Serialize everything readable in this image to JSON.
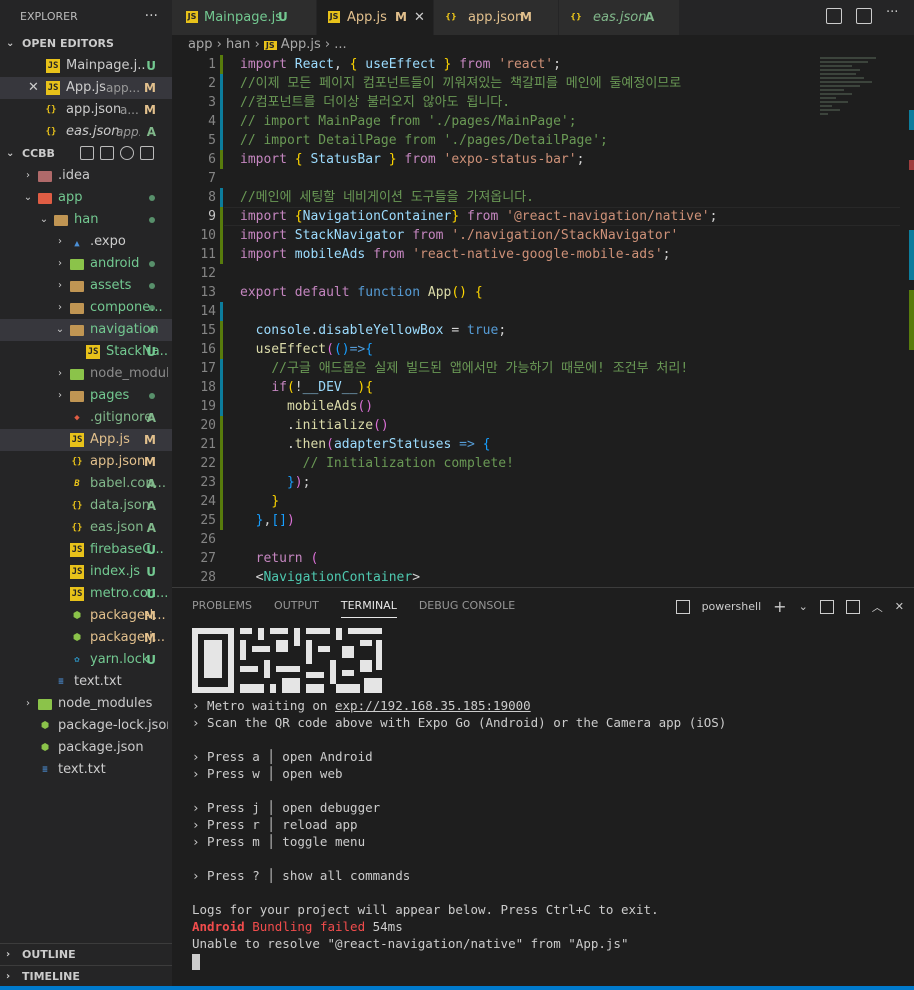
{
  "explorer": {
    "title": "EXPLORER",
    "more": "···",
    "open_editors": {
      "header": "OPEN EDITORS",
      "items": [
        {
          "name": "Mainpage.j...",
          "detail": "",
          "status": "U",
          "icon": "js-icon"
        },
        {
          "name": "App.js",
          "detail": "app...",
          "status": "M",
          "icon": "js-icon"
        },
        {
          "name": "app.json",
          "detail": "a...",
          "status": "M",
          "icon": "json-icon"
        },
        {
          "name": "eas.json",
          "detail": "app...",
          "status": "A",
          "icon": "json-icon"
        }
      ]
    },
    "project": {
      "header": "CCBB",
      "tree": [
        {
          "name": ".idea",
          "status": ""
        },
        {
          "name": "app",
          "status": ""
        },
        {
          "name": "han",
          "status": ""
        },
        {
          "name": ".expo",
          "status": ""
        },
        {
          "name": "android",
          "status": ""
        },
        {
          "name": "assets",
          "status": ""
        },
        {
          "name": "compone...",
          "status": ""
        },
        {
          "name": "navigation",
          "status": ""
        },
        {
          "name": "StackNa...",
          "status": "U"
        },
        {
          "name": "node_modules",
          "status": ""
        },
        {
          "name": "pages",
          "status": ""
        },
        {
          "name": ".gitignore",
          "status": "A"
        },
        {
          "name": "App.js",
          "status": "M"
        },
        {
          "name": "app.json",
          "status": "M"
        },
        {
          "name": "babel.con...",
          "status": "A"
        },
        {
          "name": "data.json",
          "status": "A"
        },
        {
          "name": "eas.json",
          "status": "A"
        },
        {
          "name": "firebaseC...",
          "status": "U"
        },
        {
          "name": "index.js",
          "status": "U"
        },
        {
          "name": "metro.con...",
          "status": "U"
        },
        {
          "name": "package-l...",
          "status": "M"
        },
        {
          "name": "package.j...",
          "status": "M"
        },
        {
          "name": "yarn.lock",
          "status": "U"
        },
        {
          "name": "text.txt",
          "status": ""
        },
        {
          "name": "node_modules",
          "status": ""
        },
        {
          "name": "package-lock.json",
          "status": ""
        },
        {
          "name": "package.json",
          "status": ""
        },
        {
          "name": "text.txt",
          "status": ""
        }
      ]
    },
    "outline": "OUTLINE",
    "timeline": "TIMELINE"
  },
  "tabs": [
    {
      "name": "Mainpage.js",
      "status": "U"
    },
    {
      "name": "App.js",
      "status": "M"
    },
    {
      "name": "app.json",
      "status": "M"
    },
    {
      "name": "eas.json",
      "status": "A"
    }
  ],
  "breadcrumb": [
    "app",
    "han",
    "App.js",
    "..."
  ],
  "editor": {
    "line_numbers": [
      "1",
      "2",
      "3",
      "4",
      "5",
      "6",
      "7",
      "8",
      "9",
      "10",
      "11",
      "12",
      "13",
      "14",
      "15",
      "16",
      "17",
      "18",
      "19",
      "20",
      "21",
      "22",
      "23",
      "24",
      "25",
      "26",
      "27",
      "28"
    ],
    "comments": {
      "l2": "//이제 모든 페이지 컴포넌트들이 끼워져있는 책갈피를 메인에 둘예정이므로",
      "l3": "//컴포넌트를 더이상 불러오지 않아도 됩니다.",
      "l4": "// import MainPage from './pages/MainPage';",
      "l5": "// import DetailPage from './pages/DetailPage';",
      "l8": "//메인에 세팅할 네비게이션 도구들을 가져옵니다.",
      "l17": "//구글 애드몹은 실제 빌드된 앱에서만 가능하기 때문에! 조건부 처리!",
      "l22": "// Initialization complete!"
    },
    "strings": {
      "react": "'react'",
      "expo_status_bar": "'expo-status-bar'",
      "nav_native": "'@react-navigation/native'",
      "stack_nav": "'./navigation/StackNavigator'",
      "ads": "'react-native-google-mobile-ads'"
    }
  },
  "panel": {
    "tabs": [
      "PROBLEMS",
      "OUTPUT",
      "TERMINAL",
      "DEBUG CONSOLE"
    ],
    "active_tab": "TERMINAL",
    "shell": "powershell",
    "terminal": {
      "metro": "› Metro waiting on ",
      "metro_url": "exp://192.168.35.185:19000",
      "scan": "› Scan the QR code above with Expo Go (Android) or the Camera app (iOS)",
      "press_a": "› Press a │ open Android",
      "press_w": "› Press w │ open web",
      "press_j": "› Press j │ open debugger",
      "press_r": "› Press r │ reload app",
      "press_m": "› Press m │ toggle menu",
      "press_q": "› Press ? │ show all commands",
      "logs": "Logs for your project will appear below. Press Ctrl+C to exit.",
      "bundling_platform": "Android",
      "bundling_msg": " Bundling failed ",
      "bundling_time": "54ms",
      "error": "Unable to resolve \"@react-navigation/native\" from \"App.js\""
    }
  },
  "colors": {
    "modified": "#e2c08d",
    "untracked": "#73c991",
    "added": "#81b88b",
    "error": "#f14c4c",
    "accent": "#007acc"
  }
}
